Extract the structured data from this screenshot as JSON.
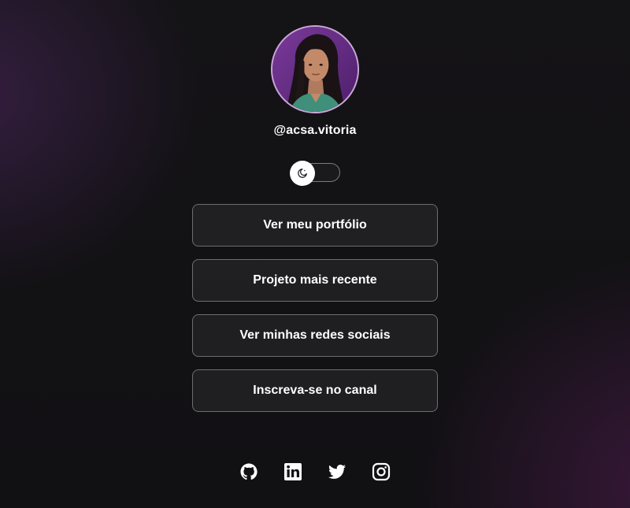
{
  "profile": {
    "handle": "@acsa.vitoria",
    "avatar_icon": "profile-photo"
  },
  "theme_toggle": {
    "icon": "moon-icon",
    "state": "dark"
  },
  "links": [
    {
      "label": "Ver meu portfólio"
    },
    {
      "label": "Projeto mais recente"
    },
    {
      "label": "Ver minhas redes sociais"
    },
    {
      "label": "Inscreva-se no canal"
    }
  ],
  "social": [
    {
      "icon": "github-icon"
    },
    {
      "icon": "linkedin-icon"
    },
    {
      "icon": "twitter-icon"
    },
    {
      "icon": "instagram-icon"
    }
  ],
  "colors": {
    "background": "#121114",
    "text": "#ffffff",
    "button_border": "#6f6c74",
    "avatar_border": "#c9a7d8",
    "avatar_bg": "#6b2d8a"
  }
}
